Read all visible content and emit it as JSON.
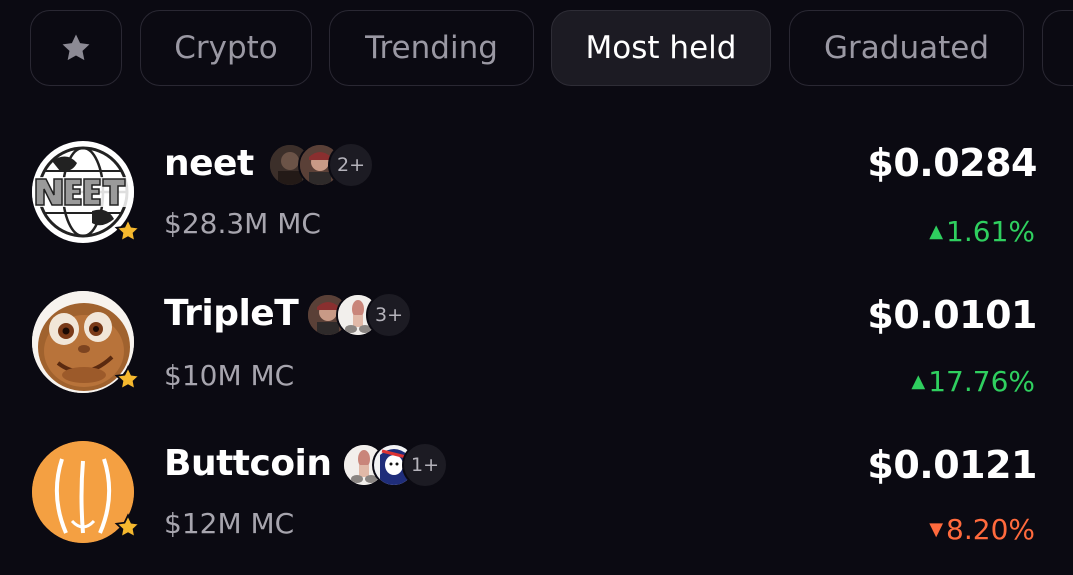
{
  "tabs": [
    {
      "label": "",
      "icon": "star-icon"
    },
    {
      "label": "Crypto"
    },
    {
      "label": "Trending"
    },
    {
      "label": "Most held",
      "active": true
    },
    {
      "label": "Graduated"
    }
  ],
  "tokens": [
    {
      "name": "neet",
      "market_cap": "$28.3M MC",
      "price": "$0.0284",
      "change": "1.61%",
      "direction": "up",
      "holders_more": "2+",
      "favorited": true
    },
    {
      "name": "TripleT",
      "market_cap": "$10M MC",
      "price": "$0.0101",
      "change": "17.76%",
      "direction": "up",
      "holders_more": "3+",
      "favorited": true
    },
    {
      "name": "Buttcoin",
      "market_cap": "$12M MC",
      "price": "$0.0121",
      "change": "8.20%",
      "direction": "down",
      "holders_more": "1+",
      "favorited": true
    }
  ],
  "glyphs": {
    "up_arrow": "▲",
    "down_arrow": "▼"
  },
  "colors": {
    "background": "#0b0a12",
    "positive": "#2fcf5f",
    "negative": "#ff6a3d",
    "star": "#f5b82e"
  }
}
